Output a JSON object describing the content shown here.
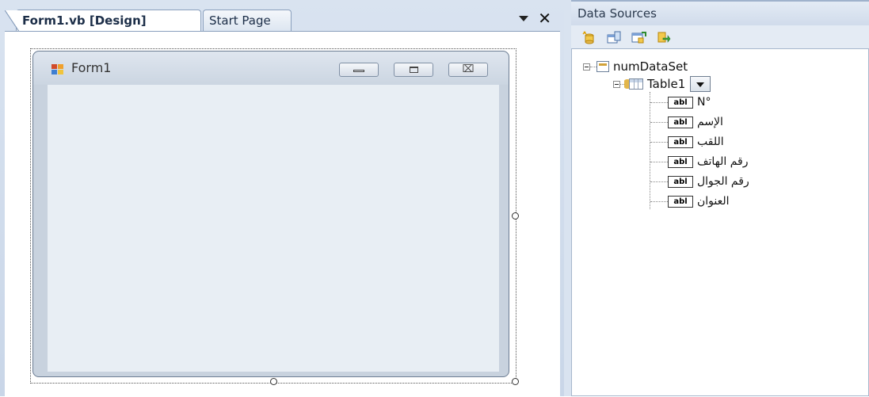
{
  "designer": {
    "tabs": [
      {
        "label": "Form1.vb [Design]",
        "active": true
      },
      {
        "label": "Start Page",
        "active": false
      }
    ],
    "close_glyph": "✕",
    "form": {
      "title": "Form1",
      "close_glyph": "⌧"
    }
  },
  "data_sources": {
    "title": "Data Sources",
    "toolbar": [
      {
        "icon": "add-data-source-icon"
      },
      {
        "icon": "edit-dataset-designer-icon"
      },
      {
        "icon": "configure-dataset-icon"
      },
      {
        "icon": "refresh-icon"
      }
    ],
    "tree": {
      "dataset": "numDataSet",
      "table": "Table1",
      "field_icon_text": "abl",
      "fields": [
        "N°",
        "الإسم",
        "اللقب",
        "رقم الهاتف",
        "رقم الجوال",
        "العنوان"
      ]
    }
  },
  "colors": {
    "panel_bg": "#d9e3f0",
    "form_client": "#e8eef4",
    "accent_yellow": "#e3b64a"
  }
}
